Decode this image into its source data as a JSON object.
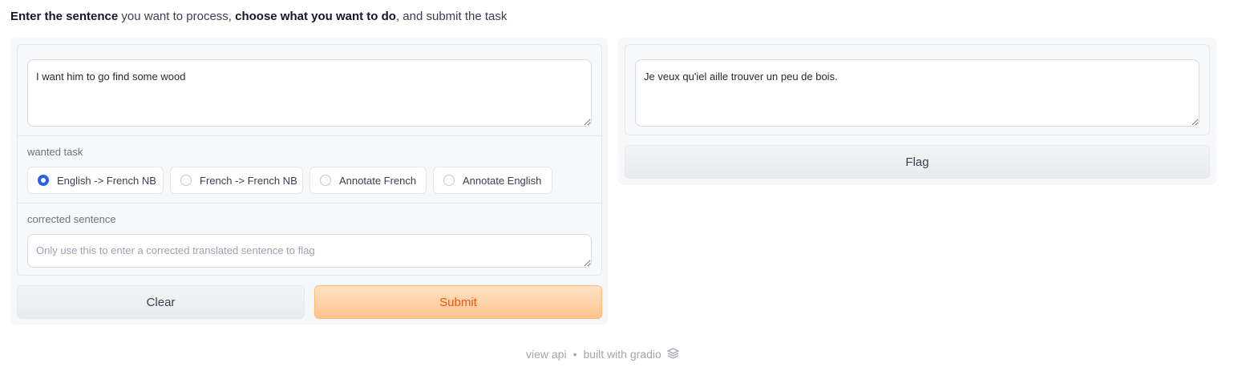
{
  "intro": {
    "part1_bold": "Enter the sentence",
    "part2": " you want to process, ",
    "part3_bold": "choose what you want to do",
    "part4": ", and submit the task"
  },
  "input": {
    "value": "I want him to go find some wood"
  },
  "task": {
    "label": "wanted task",
    "options": [
      "English -> French NB",
      "French -> French NB",
      "Annotate French",
      "Annotate English"
    ],
    "selected_index": 0
  },
  "corrected": {
    "label": "corrected sentence",
    "placeholder": "Only use this to enter a corrected translated sentence to flag"
  },
  "buttons": {
    "clear": "Clear",
    "submit": "Submit",
    "flag": "Flag"
  },
  "output": {
    "value": "Je veux qu'iel aille trouver un peu de bois."
  },
  "footer": {
    "view_api": "view api",
    "separator": "•",
    "built_with": "built with gradio",
    "logo_icon": "gradio-logo-icon"
  },
  "colors": {
    "accent": "#2563eb",
    "primary_text": "#ea580c",
    "primary_bg": "#fdc48d"
  }
}
